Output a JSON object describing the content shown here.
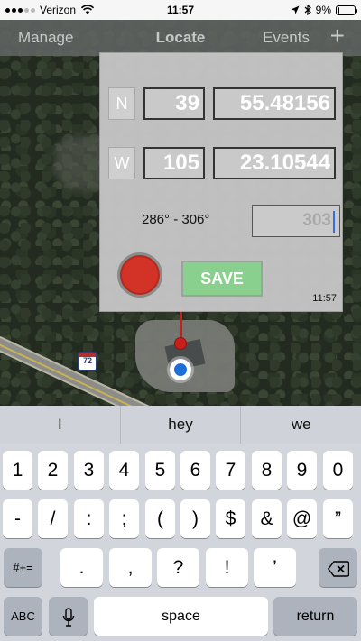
{
  "status_bar": {
    "carrier": "Verizon",
    "time": "11:57",
    "battery_percent": "9%",
    "battery_level": 0.09
  },
  "nav": {
    "left": "Manage",
    "title": "Locate",
    "right": "Events",
    "add_symbol": "+"
  },
  "panel": {
    "lat_dir": "N",
    "lat_deg": "39",
    "lat_min": "55.48156",
    "lon_dir": "W",
    "lon_deg": "105",
    "lon_min": "23.10544",
    "bearing_range": "286° - 306°",
    "bearing_value": "303",
    "save_label": "SAVE",
    "timestamp": "11:57"
  },
  "map": {
    "route_shield": "72"
  },
  "keyboard": {
    "suggestions": [
      "I",
      "hey",
      "we"
    ],
    "row1": [
      "1",
      "2",
      "3",
      "4",
      "5",
      "6",
      "7",
      "8",
      "9",
      "0"
    ],
    "row2": [
      "-",
      "/",
      ":",
      ";",
      "(",
      ")",
      "$",
      "&",
      "@",
      "”"
    ],
    "row3": [
      ".",
      ",",
      "?",
      "!",
      "’"
    ],
    "symbols_key": "#+=",
    "abc_key": "ABC",
    "space_key": "space",
    "return_key": "return"
  },
  "colors": {
    "record": "#d23326",
    "save": "#89d08f",
    "pin": "#c81f1b",
    "user_location": "#1d6fd8"
  }
}
